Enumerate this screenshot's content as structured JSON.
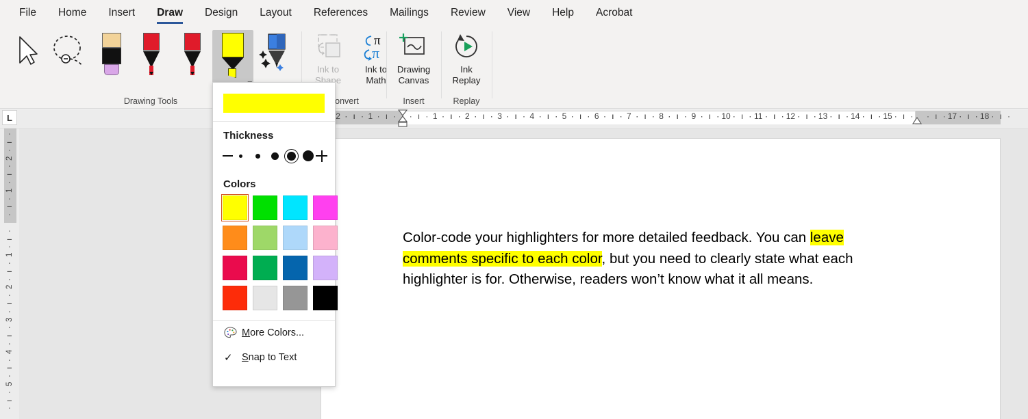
{
  "ribbon": {
    "tabs": [
      {
        "label": "File",
        "active": false
      },
      {
        "label": "Home",
        "active": false
      },
      {
        "label": "Insert",
        "active": false
      },
      {
        "label": "Draw",
        "active": true
      },
      {
        "label": "Design",
        "active": false
      },
      {
        "label": "Layout",
        "active": false
      },
      {
        "label": "References",
        "active": false
      },
      {
        "label": "Mailings",
        "active": false
      },
      {
        "label": "Review",
        "active": false
      },
      {
        "label": "View",
        "active": false
      },
      {
        "label": "Help",
        "active": false
      },
      {
        "label": "Acrobat",
        "active": false
      }
    ],
    "groups": {
      "drawing_tools": "Drawing Tools",
      "convert": "Convert",
      "insert": "Insert",
      "replay": "Replay"
    },
    "tools": [
      {
        "name": "select-tool",
        "icon": "cursor-arrow-icon"
      },
      {
        "name": "lasso-select-tool",
        "icon": "lasso-select-icon"
      },
      {
        "name": "eraser-tool",
        "icon": "eraser-icon"
      },
      {
        "name": "pen-red-tool",
        "icon": "pen-icon",
        "color": "#e01b2a"
      },
      {
        "name": "pen-red-2-tool",
        "icon": "pen-icon",
        "color": "#e01b2a"
      },
      {
        "name": "highlighter-yellow-tool",
        "icon": "highlighter-icon",
        "color": "#ffff00",
        "selected": true
      },
      {
        "name": "action-pen-tool",
        "icon": "action-pen-icon",
        "color": "#3b7fe0"
      }
    ],
    "buttons": [
      {
        "label_line1": "Ink to",
        "label_line2": "Shape",
        "name": "ink-to-shape-button",
        "disabled": true
      },
      {
        "label_line1": "Ink to",
        "label_line2": "Math",
        "name": "ink-to-math-button",
        "disabled": false
      },
      {
        "label_line1": "Drawing",
        "label_line2": "Canvas",
        "name": "drawing-canvas-button",
        "disabled": false
      },
      {
        "label_line1": "Ink",
        "label_line2": "Replay",
        "name": "ink-replay-button",
        "disabled": false
      }
    ]
  },
  "flyout": {
    "preview_color": "#ffff00",
    "thickness": {
      "title": "Thickness",
      "selected_index": 3,
      "sizes": [
        5,
        7,
        11,
        13,
        16
      ]
    },
    "colors": {
      "title": "Colors",
      "selected_index": 0,
      "swatches": [
        "#ffff00",
        "#00e000",
        "#00e5ff",
        "#ff40ef",
        "#ff8c1a",
        "#9ed868",
        "#aed8fa",
        "#fcb2cd",
        "#ea0b4d",
        "#00ad51",
        "#0565ad",
        "#d3b2fa",
        "#fd2c09",
        "#e6e6e6",
        "#969696",
        "#000000"
      ]
    },
    "menu": [
      {
        "label": "More Colors...",
        "name": "more-colors-menu-item",
        "icon": "palette-icon",
        "checked": false
      },
      {
        "label": "Snap to Text",
        "name": "snap-to-text-menu-item",
        "icon": "none",
        "checked": true
      }
    ]
  },
  "ruler": {
    "tab_selector": "L",
    "horizontal_labels": [
      "2",
      "1",
      "1",
      "2",
      "3",
      "4",
      "5",
      "6",
      "7",
      "8",
      "9",
      "10",
      "11",
      "12",
      "13",
      "14",
      "15",
      "17",
      "18"
    ],
    "vertical_labels": [
      "2",
      "1",
      "1",
      "2",
      "3",
      "4",
      "5"
    ]
  },
  "document": {
    "paragraph": {
      "part1": "Color-code your highlighters for more detailed feedback. You can ",
      "highlighted": "leave comments specific to each color",
      "part2": ", but you need to clearly state what each highlighter is for. Otherwise, readers won’t know what it all means."
    }
  }
}
